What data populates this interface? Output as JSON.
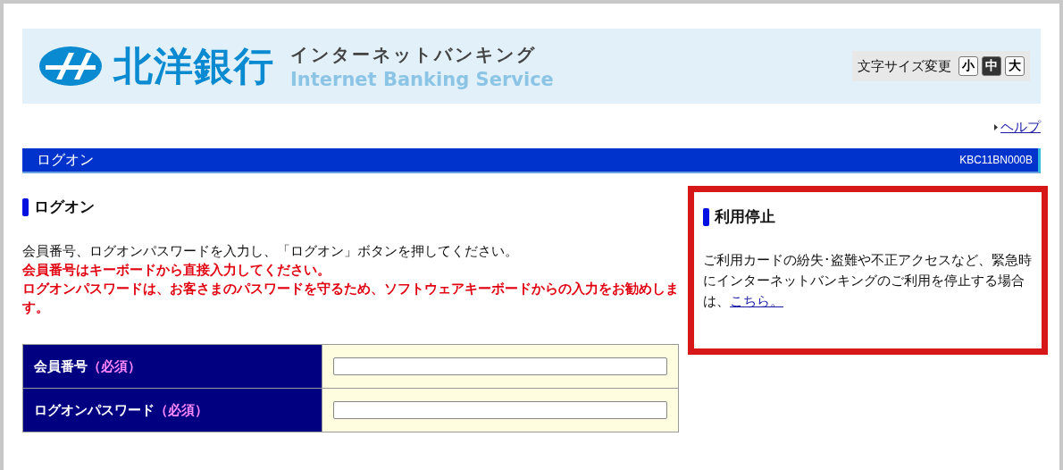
{
  "header": {
    "bank_name": "北洋銀行",
    "service_name": "インターネットバンキング",
    "service_name_en": "Internet Banking Service",
    "font_size": {
      "label": "文字サイズ変更",
      "options": [
        {
          "label": "小",
          "selected": false
        },
        {
          "label": "中",
          "selected": true
        },
        {
          "label": "大",
          "selected": false
        }
      ]
    }
  },
  "help_link": "ヘルプ",
  "page_bar": {
    "title": "ログオン",
    "code": "KBC11BN000B"
  },
  "logon": {
    "heading": "ログオン",
    "instructions": [
      {
        "text": "会員番号、ログオンパスワードを入力し、「ログオン」ボタンを押してください。",
        "kind": "normal"
      },
      {
        "text": "会員番号はキーボードから直接入力してください。",
        "kind": "warning"
      },
      {
        "text": "ログオンパスワードは、お客さまのパスワードを守るため、ソフトウェアキーボードからの入力をお勧めします。",
        "kind": "warning"
      }
    ],
    "fields": [
      {
        "label": "会員番号",
        "required": "（必須）"
      },
      {
        "label": "ログオンパスワード",
        "required": "（必須）"
      }
    ]
  },
  "suspension": {
    "heading": "利用停止",
    "text": "ご利用カードの紛失･盗難や不正アクセスなど、緊急時にインターネットバンキングのご利用を停止する場合は、",
    "link": "こちら。"
  }
}
